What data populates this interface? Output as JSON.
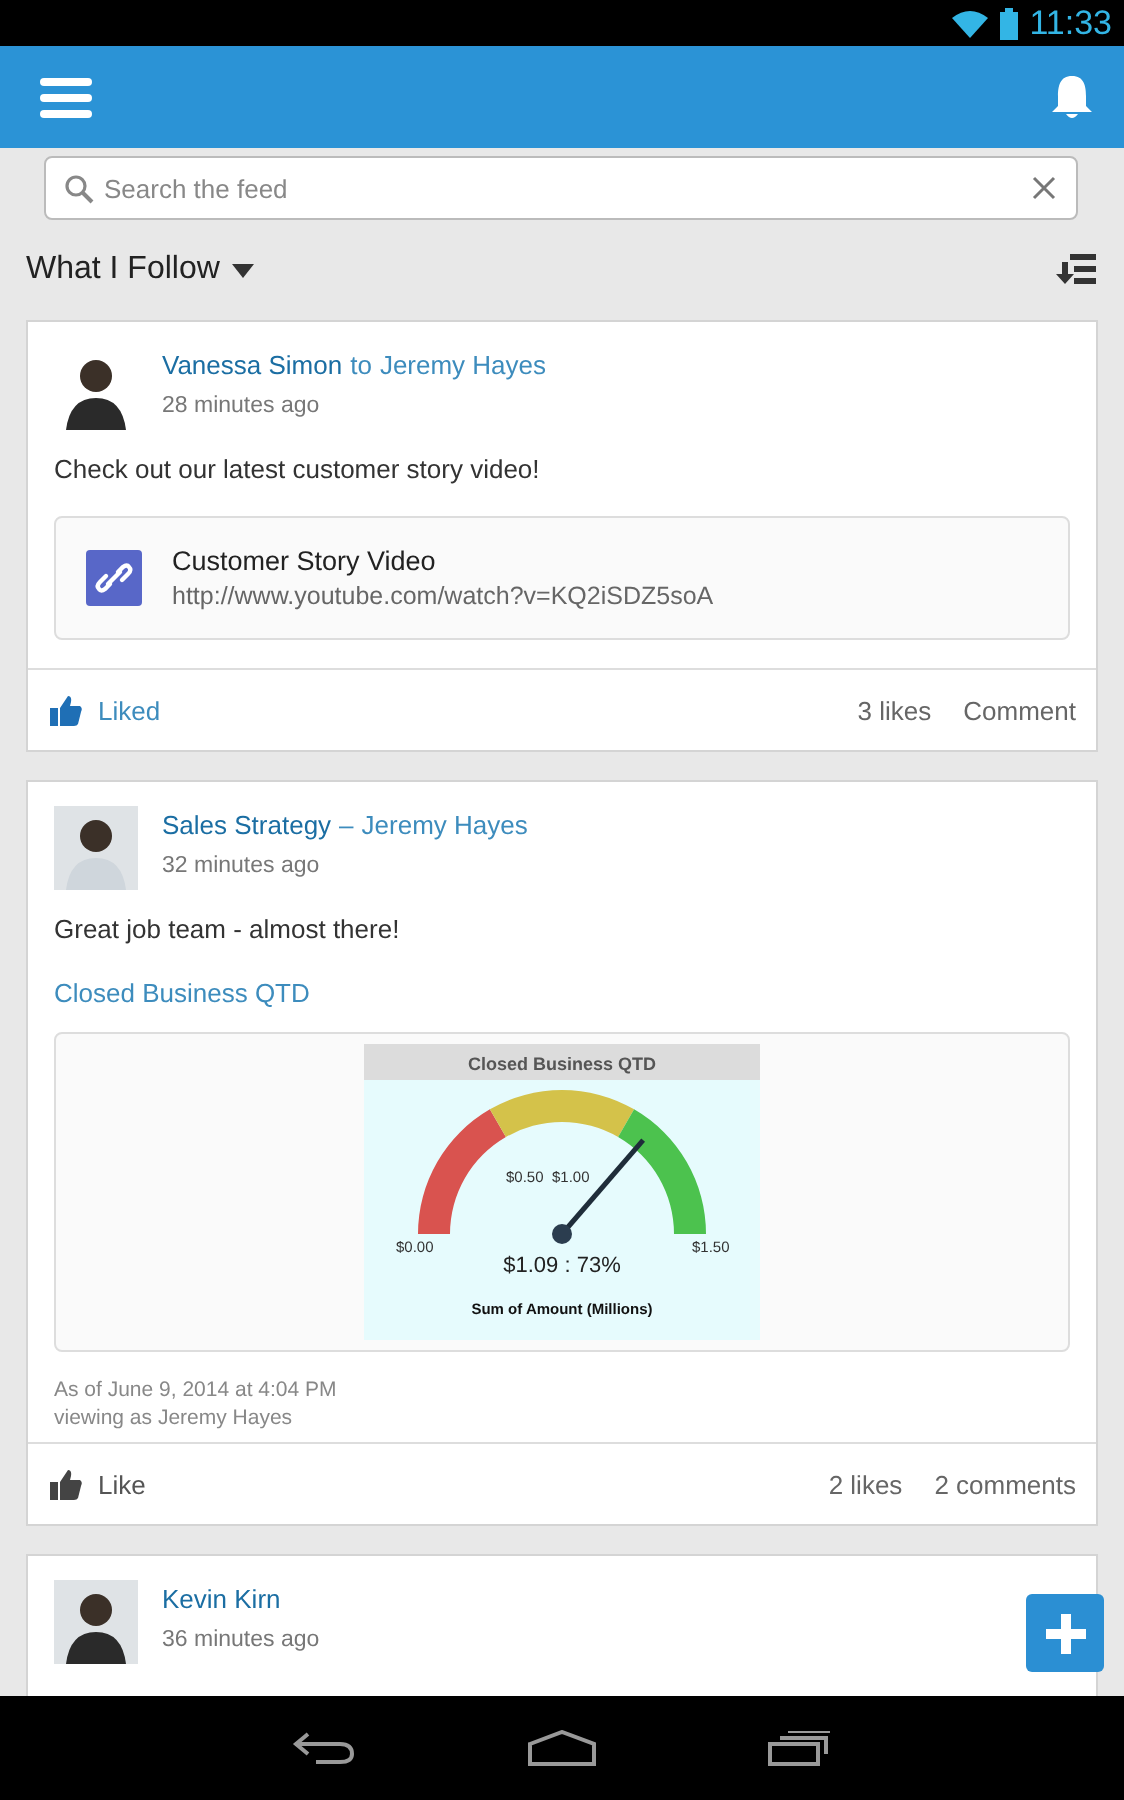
{
  "status_bar": {
    "time": "11:33"
  },
  "search": {
    "placeholder": "Search the feed"
  },
  "feed_filter": {
    "label": "What I Follow"
  },
  "posts": [
    {
      "author": "Vanessa Simon",
      "connector": "to",
      "target": "Jeremy Hayes",
      "time": "28 minutes ago",
      "body": "Check out our latest customer story video!",
      "attachment": {
        "kind": "link",
        "title": "Customer Story Video",
        "url": "http://www.youtube.com/watch?v=KQ2iSDZ5soA"
      },
      "footer": {
        "liked": true,
        "like_label": "Liked",
        "likes": "3 likes",
        "comments": "Comment"
      }
    },
    {
      "author": "Sales Strategy",
      "connector": "–",
      "target": "Jeremy Hayes",
      "time": "32 minutes ago",
      "body": "Great job team - almost there!",
      "attachment": {
        "kind": "gauge",
        "link": "Closed Business QTD",
        "title": "Closed Business QTD",
        "ticks": [
          "$0.00",
          "$0.50",
          "$1.00",
          "$1.50"
        ],
        "reading": "$1.09 : 73%",
        "caption": "Sum of Amount (Millions)",
        "as_of": "As of June 9, 2014 at 4:04 PM",
        "viewing_as": "viewing as Jeremy Hayes"
      },
      "footer": {
        "liked": false,
        "like_label": "Like",
        "likes": "2 likes",
        "comments": "2 comments"
      }
    },
    {
      "author": "Kevin Kirn",
      "time": "36 minutes ago"
    }
  ]
}
